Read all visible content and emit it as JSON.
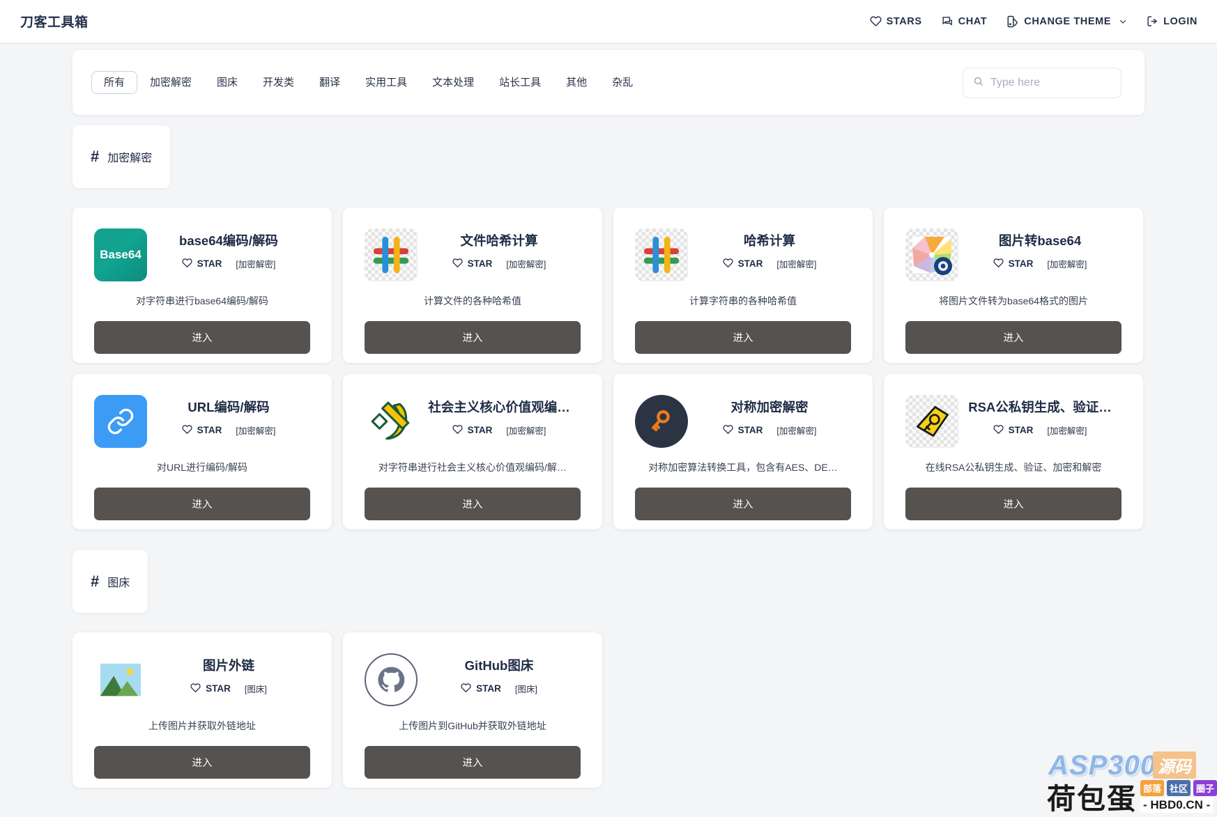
{
  "header": {
    "brand": "刀客工具箱",
    "nav": [
      {
        "label": "STARS",
        "icon": "heart-icon"
      },
      {
        "label": "CHAT",
        "icon": "chat-bubble-icon"
      },
      {
        "label": "CHANGE THEME",
        "icon": "theme-palette-icon",
        "has_chevron": true
      },
      {
        "label": "LOGIN",
        "icon": "login-arrow-icon"
      }
    ]
  },
  "filterbar": {
    "tabs": [
      {
        "label": "所有",
        "active": true
      },
      {
        "label": "加密解密",
        "active": false
      },
      {
        "label": "图床",
        "active": false
      },
      {
        "label": "开发类",
        "active": false
      },
      {
        "label": "翻译",
        "active": false
      },
      {
        "label": "实用工具",
        "active": false
      },
      {
        "label": "文本处理",
        "active": false
      },
      {
        "label": "站长工具",
        "active": false
      },
      {
        "label": "其他",
        "active": false
      },
      {
        "label": "杂乱",
        "active": false
      }
    ],
    "search": {
      "value": "",
      "placeholder": "Type here",
      "icon": "search-icon"
    }
  },
  "labels": {
    "hash": "#",
    "star": "STAR",
    "enter": "进入"
  },
  "sections": [
    {
      "title": "加密解密",
      "cards": [
        {
          "title": "base64编码/解码",
          "star": "STAR",
          "category": "[加密解密]",
          "desc": "对字符串进行base64编码/解码",
          "button": "进入",
          "icon": "base64-icon"
        },
        {
          "title": "文件哈希计算",
          "star": "STAR",
          "category": "[加密解密]",
          "desc": "计算文件的各种哈希值",
          "button": "进入",
          "icon": "hash-color-icon"
        },
        {
          "title": "哈希计算",
          "star": "STAR",
          "category": "[加密解密]",
          "desc": "计算字符串的各种哈希值",
          "button": "进入",
          "icon": "hash-color-icon"
        },
        {
          "title": "图片转base64",
          "star": "STAR",
          "category": "[加密解密]",
          "desc": "将图片文件转为base64格式的图片",
          "button": "进入",
          "icon": "color-wheel-icon"
        },
        {
          "title": "URL编码/解码",
          "star": "STAR",
          "category": "[加密解密]",
          "desc": "对URL进行编码/解码",
          "button": "进入",
          "icon": "link-icon"
        },
        {
          "title": "社会主义核心价值观编…",
          "star": "STAR",
          "category": "[加密解密]",
          "desc": "对字符串进行社会主义核心价值观编码/解…",
          "button": "进入",
          "icon": "hammer-sickle-icon"
        },
        {
          "title": "对称加密解密",
          "star": "STAR",
          "category": "[加密解密]",
          "desc": "对称加密算法转换工具，包含有AES、DE…",
          "button": "进入",
          "icon": "key-circle-icon"
        },
        {
          "title": "RSA公私钥生成、验证…",
          "star": "STAR",
          "category": "[加密解密]",
          "desc": "在线RSA公私钥生成、验证、加密和解密",
          "button": "进入",
          "icon": "key-tag-icon"
        }
      ]
    },
    {
      "title": "图床",
      "cards": [
        {
          "title": "图片外链",
          "star": "STAR",
          "category": "[图床]",
          "desc": "上传图片并获取外链地址",
          "button": "进入",
          "icon": "picture-icon"
        },
        {
          "title": "GitHub图床",
          "star": "STAR",
          "category": "[图床]",
          "desc": "上传图片到GitHub并获取外链地址",
          "button": "进入",
          "icon": "github-icon"
        }
      ]
    }
  ],
  "watermark": {
    "asp": "ASP300",
    "source": "源码",
    "main": "荷包蛋",
    "tags": [
      "部落",
      "社区",
      "圈子"
    ],
    "domain": "- HBD0.CN -"
  },
  "colors": {
    "accent": "#1f2b45",
    "button": "#55524f",
    "page_bg": "#f4f5f7",
    "card_bg": "#ffffff"
  }
}
